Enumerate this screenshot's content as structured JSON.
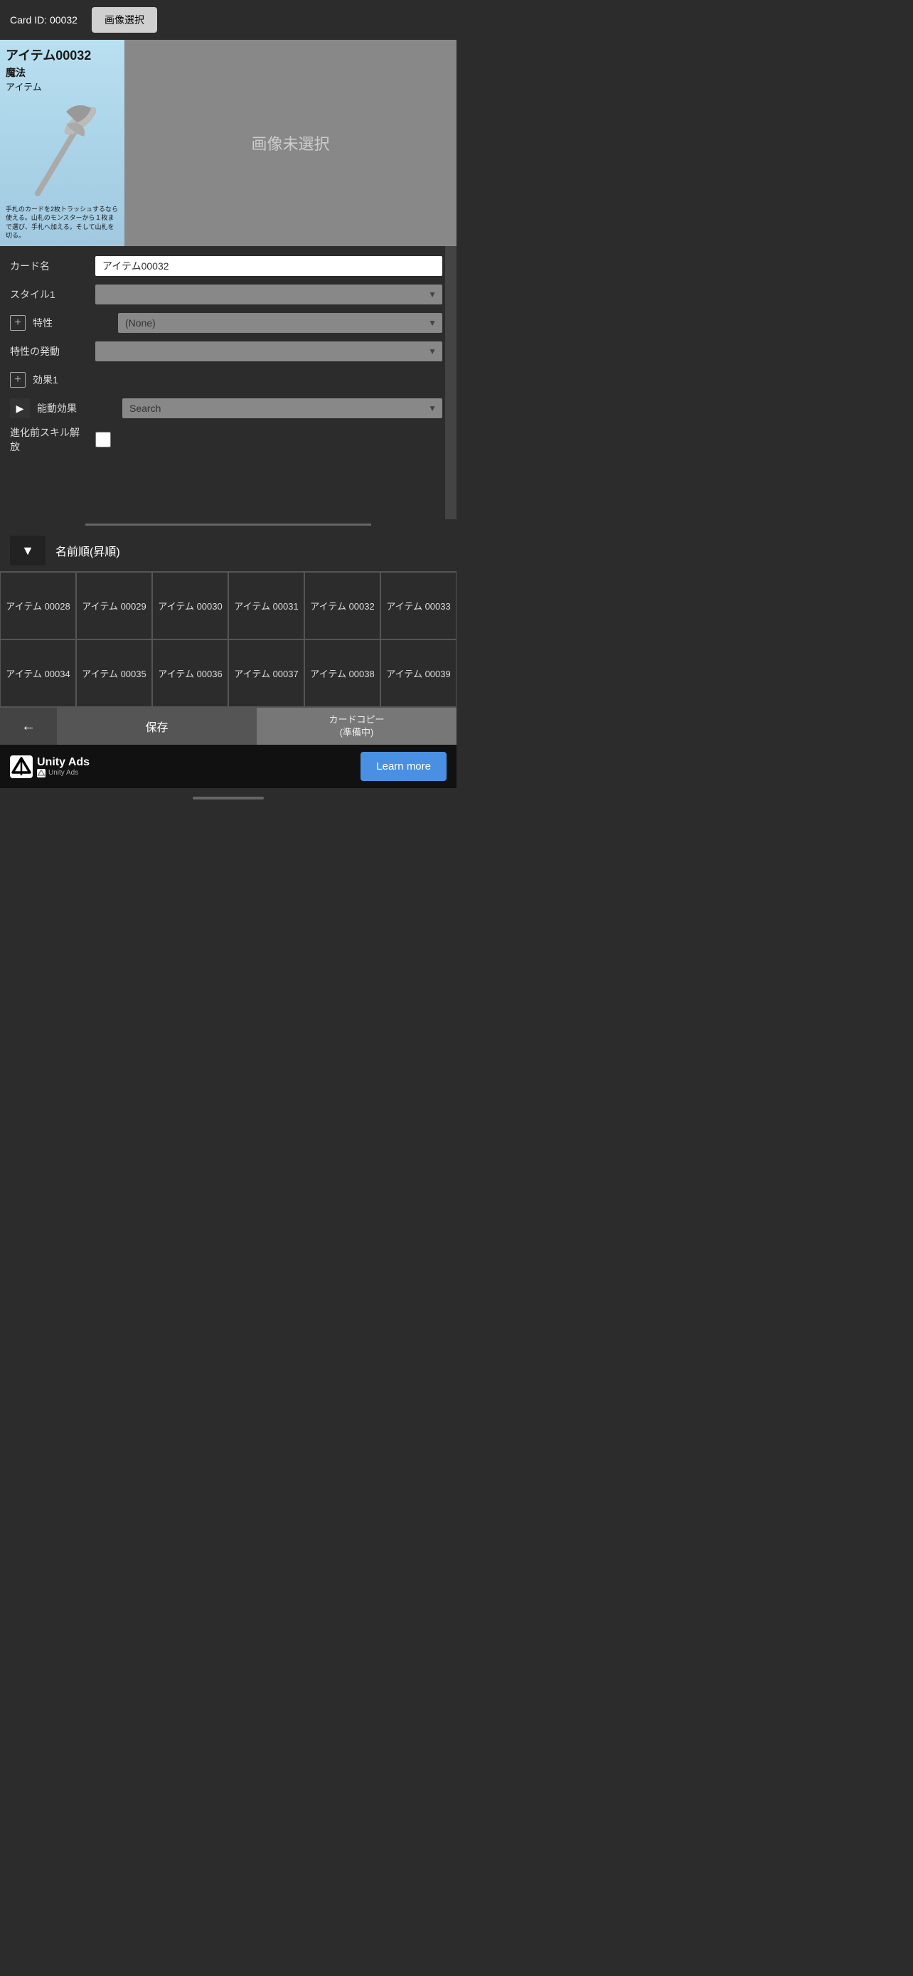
{
  "header": {
    "card_id_label": "Card ID: 00032",
    "image_select_btn": "画像選択"
  },
  "card_preview": {
    "title": "アイテム00032",
    "type_line1": "魔法",
    "type_line2": "アイテム",
    "description": "手札のカードを2枚トラッシュするなら使える。山札のモンスターから１枚まで選び、手札へ加える。そして山札を切る。",
    "no_image_text": "画像未選択"
  },
  "form": {
    "card_name_label": "カード名",
    "card_name_value": "アイテム00032",
    "style1_label": "スタイル1",
    "style1_placeholder": "",
    "trait_label": "特性",
    "trait_value": "(None)",
    "trait_trigger_label": "特性の発動",
    "effect1_label": "効果1",
    "active_effect_label": "能動効果",
    "active_effect_placeholder": "Search",
    "pre_evo_label": "進化前スキル解放"
  },
  "sort": {
    "dropdown_icon": "▼",
    "sort_label": "名前順(昇順)"
  },
  "grid": {
    "cells": [
      "アイテム\n00028",
      "アイテム\n00029",
      "アイテム\n00030",
      "アイテム\n00031",
      "アイテム\n00032",
      "アイテム\n00033",
      "アイテム\n00034",
      "アイテム\n00035",
      "アイテム\n00036",
      "アイテム\n00037",
      "アイテム\n00038",
      "アイテム\n00039"
    ]
  },
  "toolbar": {
    "back_icon": "←",
    "save_label": "保存",
    "card_copy_label": "カードコピー\n(準備中)"
  },
  "ad": {
    "brand": "Unity Ads",
    "sub": "Unity  Ads",
    "learn_more": "Learn more"
  }
}
